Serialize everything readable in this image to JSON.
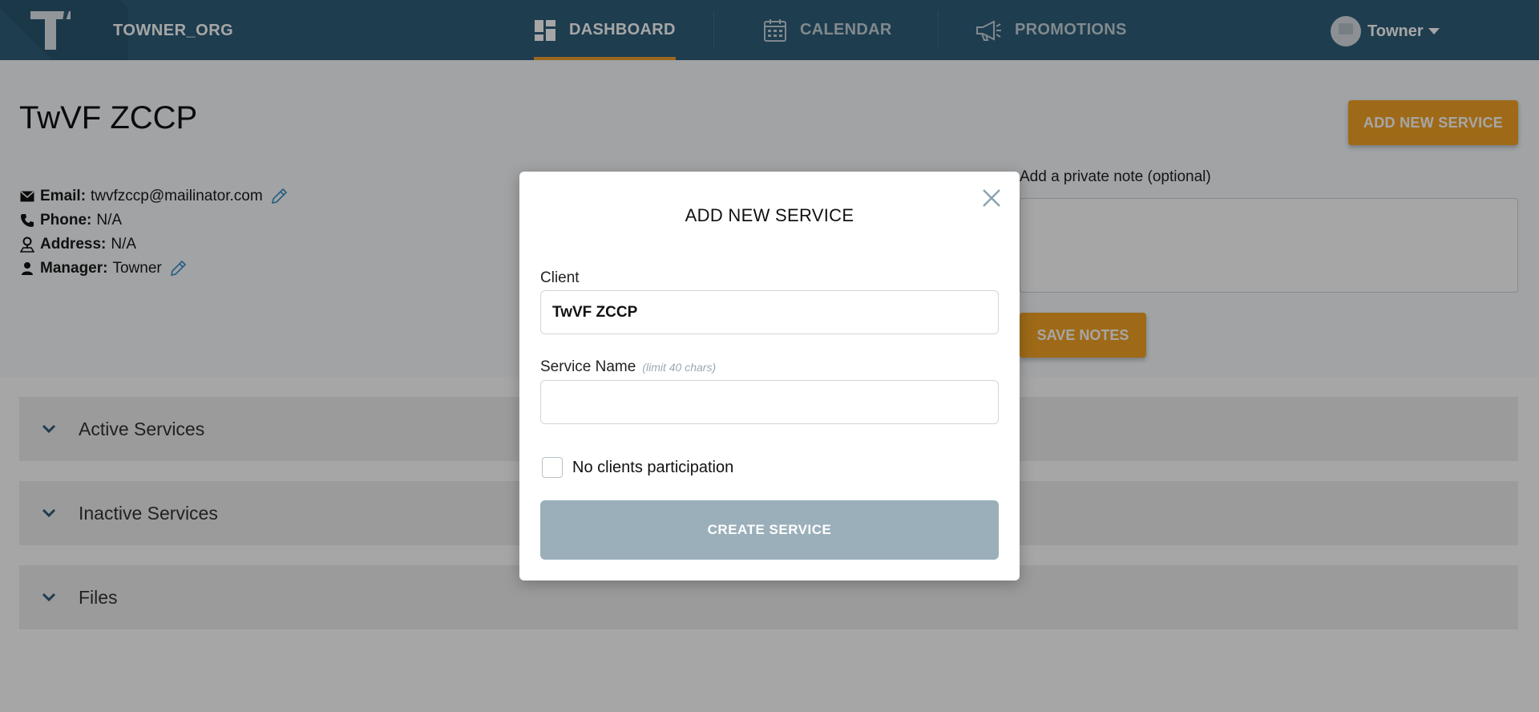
{
  "app": {
    "org_name": "TOWNER_ORG"
  },
  "nav": {
    "items": [
      {
        "label": "DASHBOARD",
        "icon": "dashboard-icon",
        "active": true
      },
      {
        "label": "CALENDAR",
        "icon": "calendar-icon",
        "active": false
      },
      {
        "label": "PROMOTIONS",
        "icon": "megaphone-icon",
        "active": false
      }
    ],
    "user_name": "Towner"
  },
  "client": {
    "name": "TwVF ZCCP",
    "email_label": "Email:",
    "email": "twvfzccp@mailinator.com",
    "phone_label": "Phone:",
    "phone": "N/A",
    "address_label": "Address:",
    "address": "N/A",
    "manager_label": "Manager:",
    "manager": "Towner"
  },
  "actions": {
    "add_new_service": "ADD NEW SERVICE",
    "note_label": "Add a private note (optional)",
    "note_value": "",
    "save_notes": "SAVE NOTES"
  },
  "sections": [
    {
      "label": "Active Services"
    },
    {
      "label": "Inactive Services"
    },
    {
      "label": "Files"
    }
  ],
  "modal": {
    "title": "ADD NEW SERVICE",
    "client_label": "Client",
    "client_value": "TwVF ZCCP",
    "service_name_label": "Service Name",
    "service_name_hint": "(limit 40 chars)",
    "service_name_value": "",
    "no_participation_label": "No clients participation",
    "no_participation_checked": false,
    "create_button": "CREATE SERVICE"
  },
  "colors": {
    "topbar": "#2f5f7a",
    "accent": "#f3a326",
    "create_button_disabled": "#9aafba"
  }
}
